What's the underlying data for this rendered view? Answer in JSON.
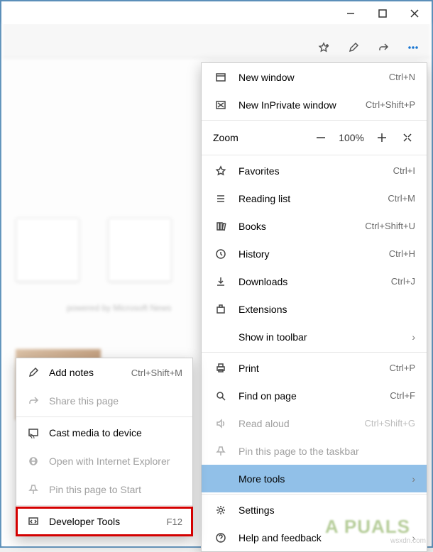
{
  "window": {
    "minimize": "—",
    "maximize": "☐",
    "close": "✕"
  },
  "iconbar": {
    "fav": "favorites-hub",
    "pen": "notes",
    "share": "share",
    "more": "more"
  },
  "menu": {
    "new_window": {
      "label": "New window",
      "shortcut": "Ctrl+N"
    },
    "new_inprivate": {
      "label": "New InPrivate window",
      "shortcut": "Ctrl+Shift+P"
    },
    "zoom": {
      "label": "Zoom",
      "value": "100%"
    },
    "favorites": {
      "label": "Favorites",
      "shortcut": "Ctrl+I"
    },
    "reading_list": {
      "label": "Reading list",
      "shortcut": "Ctrl+M"
    },
    "books": {
      "label": "Books",
      "shortcut": "Ctrl+Shift+U"
    },
    "history": {
      "label": "History",
      "shortcut": "Ctrl+H"
    },
    "downloads": {
      "label": "Downloads",
      "shortcut": "Ctrl+J"
    },
    "extensions": {
      "label": "Extensions"
    },
    "show_toolbar": {
      "label": "Show in toolbar"
    },
    "print": {
      "label": "Print",
      "shortcut": "Ctrl+P"
    },
    "find": {
      "label": "Find on page",
      "shortcut": "Ctrl+F"
    },
    "read_aloud": {
      "label": "Read aloud",
      "shortcut": "Ctrl+Shift+G"
    },
    "pin_taskbar": {
      "label": "Pin this page to the taskbar"
    },
    "more_tools": {
      "label": "More tools"
    },
    "settings": {
      "label": "Settings"
    },
    "help": {
      "label": "Help and feedback"
    }
  },
  "submenu": {
    "add_notes": {
      "label": "Add notes",
      "shortcut": "Ctrl+Shift+M"
    },
    "share": {
      "label": "Share this page"
    },
    "cast": {
      "label": "Cast media to device"
    },
    "open_ie": {
      "label": "Open with Internet Explorer"
    },
    "pin_start": {
      "label": "Pin this page to Start"
    },
    "devtools": {
      "label": "Developer Tools",
      "shortcut": "F12"
    }
  },
  "watermark": {
    "text": "A  PUALS",
    "src": "wsxdn.com"
  }
}
